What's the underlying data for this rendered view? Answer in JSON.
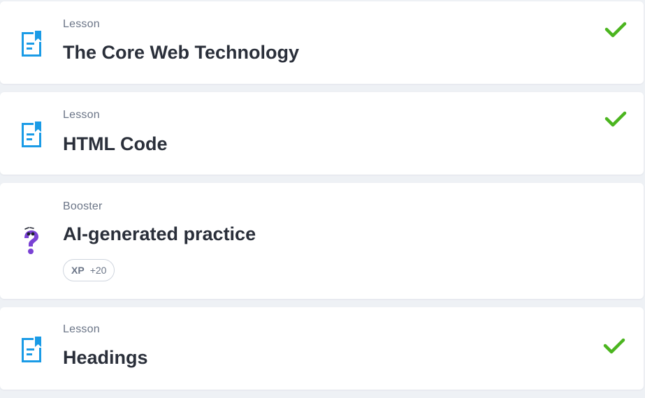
{
  "colors": {
    "page_background": "#eef1f5",
    "card_background": "#ffffff",
    "lesson_icon": "#1a9be6",
    "booster_icon": "#7a42d4",
    "check": "#4bb51f",
    "title_text": "#2a2f3a",
    "muted_text": "#6b7587"
  },
  "items": [
    {
      "type_label": "Lesson",
      "title": "The Core Web Technology",
      "icon": "lesson-document-icon",
      "completed": true
    },
    {
      "type_label": "Lesson",
      "title": "HTML Code",
      "icon": "lesson-document-icon",
      "completed": true
    },
    {
      "type_label": "Booster",
      "title": "AI-generated practice",
      "icon": "question-mark-character-icon",
      "completed": false,
      "xp": {
        "label": "XP",
        "value": "+20"
      }
    },
    {
      "type_label": "Lesson",
      "title": "Headings",
      "icon": "lesson-document-icon",
      "completed": true
    }
  ]
}
